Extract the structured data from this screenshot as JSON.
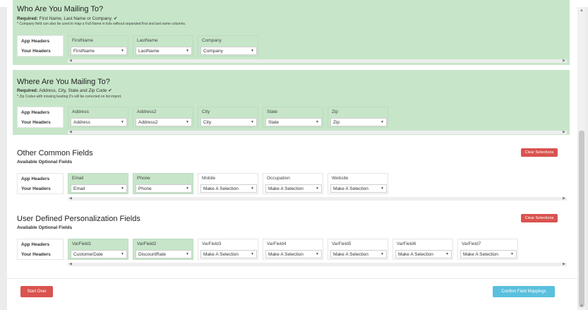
{
  "who": {
    "title": "Who Are You Mailing To?",
    "required_label": "Required:",
    "required_text": "First Name, Last Name or Company.",
    "check_icon": "check-icon",
    "note": "* Company field can also be used to map a Full Name in lists without separated first and last name columns.",
    "app_headers_label": "App Headers",
    "your_headers_label": "Your Headers",
    "columns": [
      {
        "label": "FirstName",
        "value": "FirstName"
      },
      {
        "label": "LastName",
        "value": "LastName"
      },
      {
        "label": "Company",
        "value": "Company"
      }
    ]
  },
  "where": {
    "title": "Where Are You Mailing To?",
    "required_label": "Required:",
    "required_text": "Address, City, State and Zip Code",
    "check_icon": "check-icon",
    "note": "* Zip Codes with missing leading 0's will be corrected on list import.",
    "app_headers_label": "App Headers",
    "your_headers_label": "Your Headers",
    "columns": [
      {
        "label": "Address",
        "value": "Address"
      },
      {
        "label": "Address2",
        "value": "Address2"
      },
      {
        "label": "City",
        "value": "City"
      },
      {
        "label": "State",
        "value": "State"
      },
      {
        "label": "Zip",
        "value": "Zip"
      }
    ]
  },
  "common": {
    "title": "Other Common Fields",
    "subtitle": "Available Optional Fields",
    "clear_label": "Clear Selections",
    "app_headers_label": "App Headers",
    "your_headers_label": "Your Headers",
    "columns": [
      {
        "label": "Email",
        "value": "Email"
      },
      {
        "label": "Phone",
        "value": "Phone"
      },
      {
        "label": "Mobile",
        "value": "Make A Selection"
      },
      {
        "label": "Occupation",
        "value": "Make A Selection"
      },
      {
        "label": "Website",
        "value": "Make A Selection"
      }
    ]
  },
  "user": {
    "title": "User Defined Personalization Fields",
    "subtitle": "Available Optional Fields",
    "clear_label": "Clear Selections",
    "app_headers_label": "App Headers",
    "your_headers_label": "Your Headers",
    "columns": [
      {
        "label": "VarField1",
        "value": "CustomerDate"
      },
      {
        "label": "VarField2",
        "value": "DiscountRate"
      },
      {
        "label": "VarField3",
        "value": "Make A Selection"
      },
      {
        "label": "VarField4",
        "value": "Make A Selection"
      },
      {
        "label": "VarField5",
        "value": "Make A Selection"
      },
      {
        "label": "VarField6",
        "value": "Make A Selection"
      },
      {
        "label": "VarField7",
        "value": "Make A Selection"
      }
    ]
  },
  "footer": {
    "start_over": "Start Over",
    "confirm": "Confirm Field Mappings"
  },
  "colors": {
    "section_green": "#c7e6c9",
    "danger": "#d9534f",
    "info": "#5bc0de"
  }
}
